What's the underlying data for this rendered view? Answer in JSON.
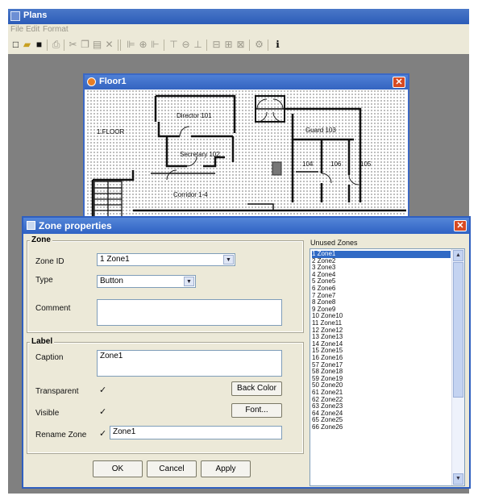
{
  "app": {
    "title": "Plans"
  },
  "menu": [
    "File",
    "Edit",
    "Format"
  ],
  "floor_window": {
    "title": "Floor1",
    "close_label": "✕",
    "labels": {
      "floor": "1.FLOOR",
      "director": "Director 101",
      "guard": "Guard 103",
      "secretary": "Secretary 102",
      "room104": "104",
      "room105": "105",
      "room106": "106",
      "corridor": "Corridor 1-4"
    }
  },
  "dialog": {
    "title": "Zone properties",
    "close_label": "✕",
    "zone_group": "Zone",
    "zone_id_label": "Zone ID",
    "zone_id_value": "1 Zone1",
    "type_label": "Type",
    "type_value": "Button",
    "comment_label": "Comment",
    "comment_value": "",
    "label_group": "Label",
    "caption_label": "Caption",
    "caption_value": "Zone1",
    "transparent_label": "Transparent",
    "visible_label": "Visible",
    "rename_label": "Rename Zone",
    "rename_value": "Zone1",
    "check_mark": "✓",
    "back_color": "Back Color",
    "font": "Font...",
    "ok": "OK",
    "cancel": "Cancel",
    "apply": "Apply",
    "unused_label": "Unused Zones",
    "unused": [
      "1 Zone1",
      "2 Zone2",
      "3 Zone3",
      "4 Zone4",
      "5 Zone5",
      "6 Zone6",
      "7 Zone7",
      "8 Zone8",
      "9 Zone9",
      "10 Zone10",
      "11 Zone11",
      "12 Zone12",
      "13 Zone13",
      "14 Zone14",
      "15 Zone15",
      "16 Zone16",
      "57 Zone17",
      "58 Zone18",
      "59 Zone19",
      "50 Zone20",
      "61 Zone21",
      "62 Zone22",
      "63 Zone23",
      "64 Zone24",
      "65 Zone25",
      "66 Zone26"
    ],
    "selected_index": 0
  }
}
